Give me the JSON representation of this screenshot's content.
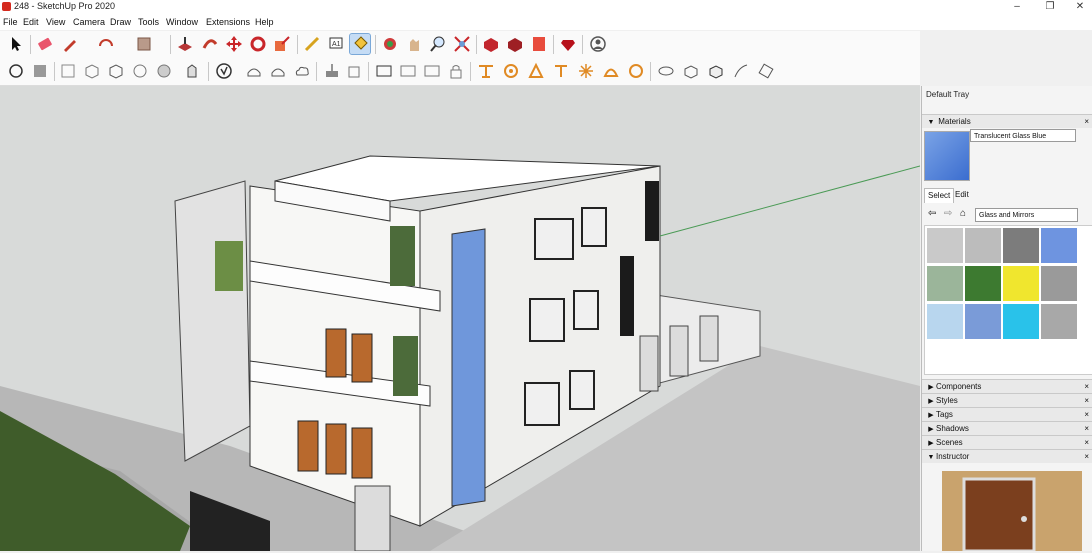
{
  "window": {
    "title": "248 - SketchUp Pro 2020",
    "controls": [
      "–",
      "❐",
      "✕"
    ]
  },
  "menu": [
    "File",
    "Edit",
    "View",
    "Camera",
    "Draw",
    "Tools",
    "Window",
    "Extensions",
    "Help"
  ],
  "toolbar_row1": [
    "select",
    "eraser",
    "pencil",
    "arc",
    "rectangle",
    "push-pull",
    "follow-me",
    "move",
    "rotate",
    "scale",
    "tape-measure",
    "text",
    "paint-bucket",
    "orbit",
    "pan",
    "zoom",
    "zoom-extents",
    "3d-warehouse",
    "extension-warehouse",
    "layout",
    "ruby",
    "account"
  ],
  "toolbar_row2": [
    "component",
    "group",
    "x-ray",
    "back-edges",
    "wireframe",
    "hidden-line",
    "shaded",
    "shaded-with-textures",
    "monochrome",
    "sandbox",
    "sandbox-from-scratch",
    "section",
    "iso",
    "top",
    "front",
    "right",
    "back",
    "left",
    "tape",
    "dimension",
    "protractor",
    "axes",
    "section-plane",
    "solid",
    "intersect",
    "union",
    "subtract",
    "trim",
    "split"
  ],
  "tray": {
    "title": "Default Tray",
    "materials": {
      "section_label": "Materials",
      "material_name": "Translucent Glass Blue",
      "tab_select": "Select",
      "tab_edit": "Edit",
      "library": "Glass and Mirrors",
      "swatch_colors": [
        "#c9c9c9",
        "#bcbcbc",
        "#7c7c7c",
        "#6e94e0",
        "#9bb59a",
        "#3d7a30",
        "#f0e62e",
        "#9a9a9a",
        "#b8d6ee",
        "#7a9bd8",
        "#29c2ea",
        "#a8a8a8"
      ]
    },
    "sections": [
      "Components",
      "Styles",
      "Tags",
      "Shadows",
      "Scenes",
      "Instructor"
    ]
  },
  "colors": {
    "accent": "#c5dcf5",
    "wall_white": "#f7f7f5",
    "glass_blue": "#6f97db",
    "wood_door": "#b8692d",
    "ground": "#c6c6c6",
    "sky": "#d8dad9"
  }
}
